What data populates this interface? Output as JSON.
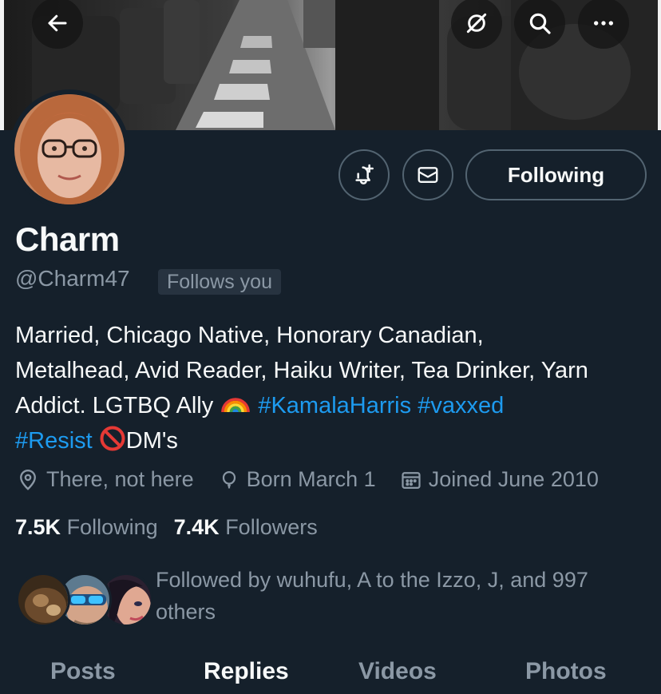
{
  "header": {
    "back_icon": "arrow-left-icon",
    "grok_icon": "grok-slash-icon",
    "search_icon": "search-icon",
    "more_icon": "more-horizontal-icon"
  },
  "actions": {
    "notify_icon": "bell-plus-icon",
    "message_icon": "envelope-icon",
    "following_label": "Following"
  },
  "profile": {
    "display_name": "Charm",
    "handle": "@Charm47",
    "follows_you": "Follows you",
    "bio": {
      "line1": "Married, Chicago Native, Honorary Canadian,",
      "line2": "Metalhead, Avid Reader, Haiku Writer, Tea Drinker, Yarn",
      "line3_text": "Addict. LGTBQ Ally ",
      "hashtag1": "#KamalaHarris",
      "hashtag2": "#vaxxed",
      "hashtag3": "#Resist",
      "line4_tail": "DM's"
    },
    "location": "There, not here",
    "birthday": "Born March 1",
    "joined": "Joined June 2010"
  },
  "stats": {
    "following_count": "7.5K",
    "following_label": "Following",
    "followers_count": "7.4K",
    "followers_label": "Followers"
  },
  "followed_by": {
    "text": "Followed by wuhufu, A to the Izzo, J, and 997 others"
  },
  "tabs": [
    {
      "label": "Posts"
    },
    {
      "label": "Replies"
    },
    {
      "label": "Videos"
    },
    {
      "label": "Photos"
    }
  ],
  "colors": {
    "background": "#15202b",
    "accent": "#1d9bf0",
    "muted_text": "#8b98a5",
    "border": "#536471"
  }
}
